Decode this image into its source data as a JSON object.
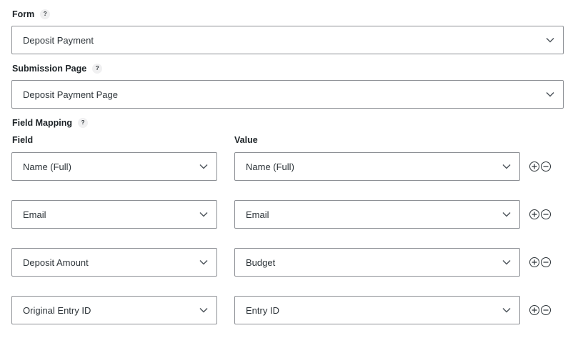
{
  "form": {
    "label": "Form",
    "help": "?",
    "selected": "Deposit Payment"
  },
  "submission_page": {
    "label": "Submission Page",
    "help": "?",
    "selected": "Deposit Payment Page"
  },
  "field_mapping": {
    "label": "Field Mapping",
    "help": "?",
    "field_header": "Field",
    "value_header": "Value",
    "rows": [
      {
        "field": "Name (Full)",
        "value": "Name (Full)"
      },
      {
        "field": "Email",
        "value": "Email"
      },
      {
        "field": "Deposit Amount",
        "value": "Budget"
      },
      {
        "field": "Original Entry ID",
        "value": "Entry ID"
      }
    ]
  },
  "icons": {
    "help": "help-icon",
    "dropdown": "chevron-down-icon",
    "add": "plus-circle-icon",
    "remove": "minus-circle-icon"
  }
}
